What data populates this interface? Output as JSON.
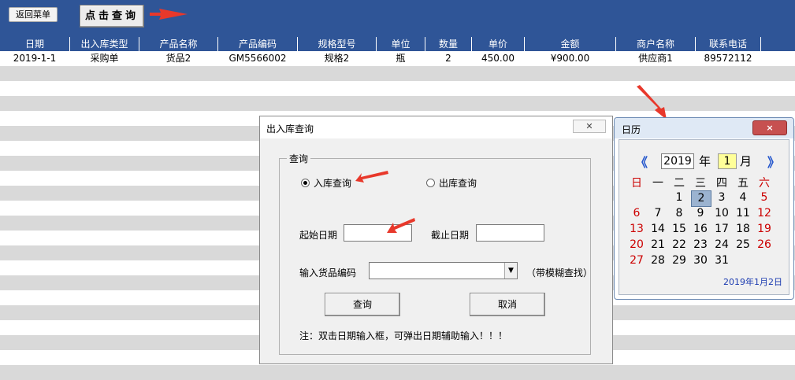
{
  "toolbar": {
    "back_label": "返回菜单",
    "query_label": "点击查询"
  },
  "table": {
    "headers": [
      "日期",
      "出入库类型",
      "产品名称",
      "产品编码",
      "规格型号",
      "单位",
      "数量",
      "单价",
      "金额",
      "商户名称",
      "联系电话"
    ],
    "rows": [
      [
        "2019-1-1",
        "采购单",
        "货品2",
        "GM5566002",
        "规格2",
        "瓶",
        "2",
        "450.00",
        "¥900.00",
        "供应商1",
        "89572112"
      ]
    ]
  },
  "dialog": {
    "title": "出入库查询",
    "group_label": "查询",
    "radio_in": "入库查询",
    "radio_out": "出库查询",
    "start_label": "起始日期",
    "end_label": "截止日期",
    "start_value": "",
    "end_value": "",
    "code_label": "输入货品编码",
    "code_value": "",
    "fuzzy_hint": "（带模糊查找）",
    "query_btn": "查询",
    "cancel_btn": "取消",
    "note": "注：双击日期输入框，可弹出日期辅助输入！！！"
  },
  "calendar": {
    "title": "日历",
    "close": "×",
    "prev": "《",
    "next": "》",
    "year": "2019",
    "year_suffix": "年",
    "month": "1",
    "month_suffix": "月",
    "weekdays": [
      "日",
      "一",
      "二",
      "三",
      "四",
      "五",
      "六"
    ],
    "days": [
      "1",
      "2",
      "3",
      "4",
      "5",
      "6",
      "7",
      "8",
      "9",
      "10",
      "11",
      "12",
      "13",
      "14",
      "15",
      "16",
      "17",
      "18",
      "19",
      "20",
      "21",
      "22",
      "23",
      "24",
      "25",
      "26",
      "27",
      "28",
      "29",
      "30",
      "31"
    ],
    "selected_day": "2",
    "footer": "2019年1月2日"
  },
  "colors": {
    "header": "#2f5597",
    "stripe": "#d9d9d9",
    "arrow": "#e8382b",
    "sunday": "#cc0000"
  }
}
